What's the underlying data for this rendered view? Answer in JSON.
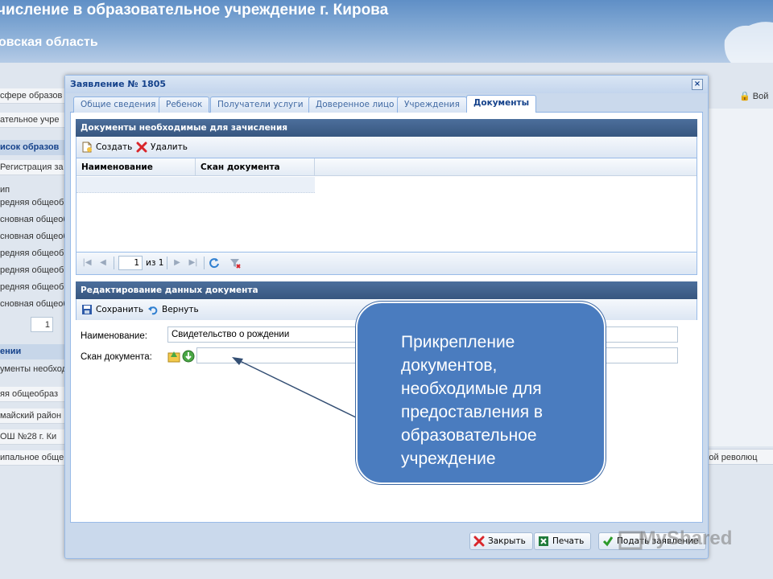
{
  "app": {
    "title": "числение в образовательное учреждение г. Кирова",
    "subtitle": "овская область",
    "login_label": "Вой",
    "left_rows": [
      "сфере образов",
      "ательное учре",
      "исок образов",
      "Регистрация за",
      "ип",
      "редняя общеобр",
      "сновная общеоб",
      "сновная общеоб",
      "редняя общеобр",
      "редняя общеобр",
      "редняя общеобр",
      "сновная общеоб",
      "1",
      "ении",
      "ументы необход",
      "яя общеобраз",
      "майский район",
      "ОШ №28 г. Ки",
      "ипальное обще"
    ],
    "right_text": "ской революц"
  },
  "dialog": {
    "title": "Заявление № 1805",
    "close_glyph": "×",
    "tabs": [
      "Общие сведения",
      "Ребенок",
      "Получатели услуги",
      "Доверенное лицо",
      "Учреждения",
      "Документы"
    ],
    "active_tab": "Документы",
    "docs_panel": {
      "title": "Документы необходимые для зачисления",
      "create_label": "Создать",
      "delete_label": "Удалить",
      "columns": [
        "Наименование",
        "Скан документа"
      ],
      "pager": {
        "page": "1",
        "of_label": "из 1"
      }
    },
    "edit_panel": {
      "title": "Редактирование данных документа",
      "save_label": "Сохранить",
      "revert_label": "Вернуть",
      "name_label": "Наименование:",
      "name_value": "Свидетельство о рождении",
      "scan_label": "Скан документа:"
    },
    "footer": {
      "close_label": "Закрыть",
      "print_label": "Печать",
      "submit_label": "Подать заявление"
    }
  },
  "callout": {
    "text": "Прикрепление документов, необходимые для предоставления в образовательное учреждение"
  },
  "watermark": "MyShared",
  "colors": {
    "accent": "#15428b",
    "panel_header": "#3f6090",
    "callout_fill": "#4a7cbf"
  }
}
